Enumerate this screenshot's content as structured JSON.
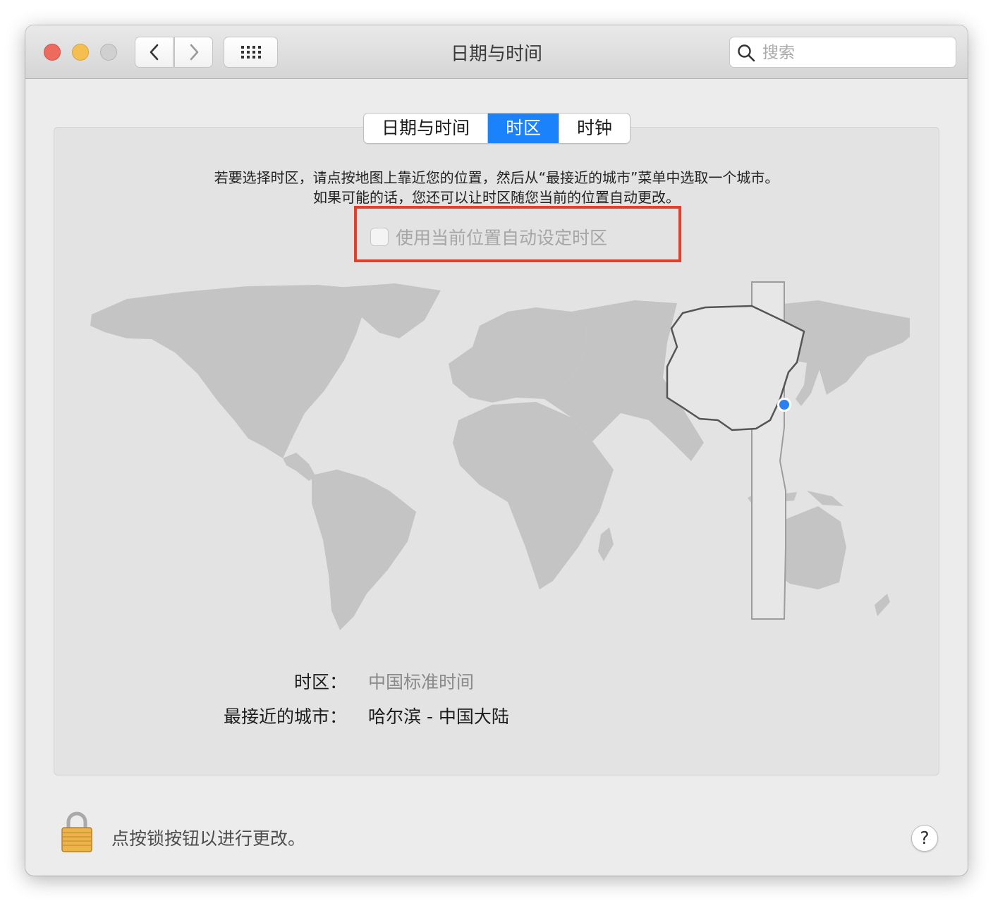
{
  "window": {
    "title": "日期与时间",
    "search_placeholder": "搜索"
  },
  "tabs": [
    {
      "label": "日期与时间",
      "active": false
    },
    {
      "label": "时区",
      "active": true
    },
    {
      "label": "时钟",
      "active": false
    }
  ],
  "timezone_panel": {
    "description_line1": "若要选择时区，请点按地图上靠近您的位置，然后从“最接近的城市”菜单中选取一个城市。",
    "description_line2": "如果可能的话，您还可以让时区随您当前的位置自动更改。",
    "auto_timezone_label": "使用当前位置自动设定时区",
    "auto_timezone_checked": false,
    "timezone_label": "时区：",
    "timezone_value": "中国标准时间",
    "closest_city_label": "最接近的城市：",
    "closest_city_value": "哈尔滨 - 中国大陆"
  },
  "footer": {
    "lock_text": "点按锁按钮以进行更改。",
    "help_label": "?"
  },
  "colors": {
    "accent": "#1a82fb",
    "highlight_border": "#e2402c",
    "close": "#ed6a5e",
    "minimize": "#f5bf4f",
    "zoom": "#d0d0d0"
  }
}
